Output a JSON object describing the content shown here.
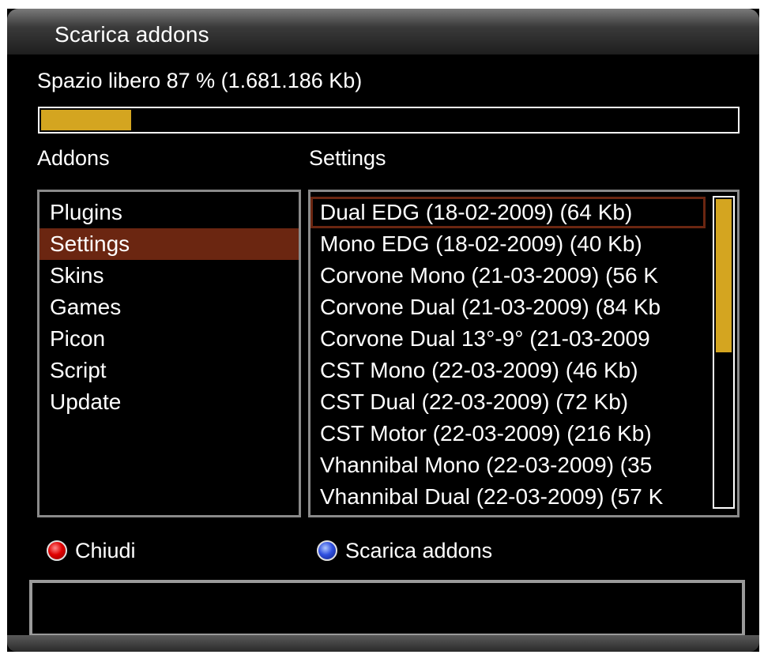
{
  "window": {
    "title": "Scarica addons"
  },
  "storage": {
    "free_text": "Spazio libero 87 % (1.681.186 Kb)",
    "used_fraction": 0.13
  },
  "addons_panel": {
    "label": "Addons",
    "selected_index": 1,
    "items": [
      "Plugins",
      "Settings",
      "Skins",
      "Games",
      "Picon",
      "Script",
      "Update"
    ]
  },
  "settings_panel": {
    "label": "Settings",
    "selected_index": 0,
    "items": [
      "Dual EDG (18-02-2009) (64 Kb)",
      "Mono EDG (18-02-2009) (40 Kb)",
      "Corvone Mono (21-03-2009) (56 K",
      "Corvone Dual (21-03-2009) (84 Kb",
      "Corvone Dual 13°-9° (21-03-2009",
      "CST Mono (22-03-2009) (46 Kb)",
      "CST Dual (22-03-2009) (72 Kb)",
      "CST Motor (22-03-2009) (216 Kb)",
      "Vhannibal Mono (22-03-2009) (35",
      "Vhannibal Dual (22-03-2009) (57 K"
    ],
    "scroll_fraction_visible": 0.5
  },
  "buttons": {
    "red_label": "Chiudi",
    "blue_label": "Scarica addons"
  },
  "status": {
    "text": ""
  },
  "colors": {
    "accent": "#d4a520",
    "selection": "#6b2611",
    "background": "#000000"
  },
  "icons": {
    "red_button": "red-button-icon",
    "blue_button": "blue-button-icon"
  }
}
